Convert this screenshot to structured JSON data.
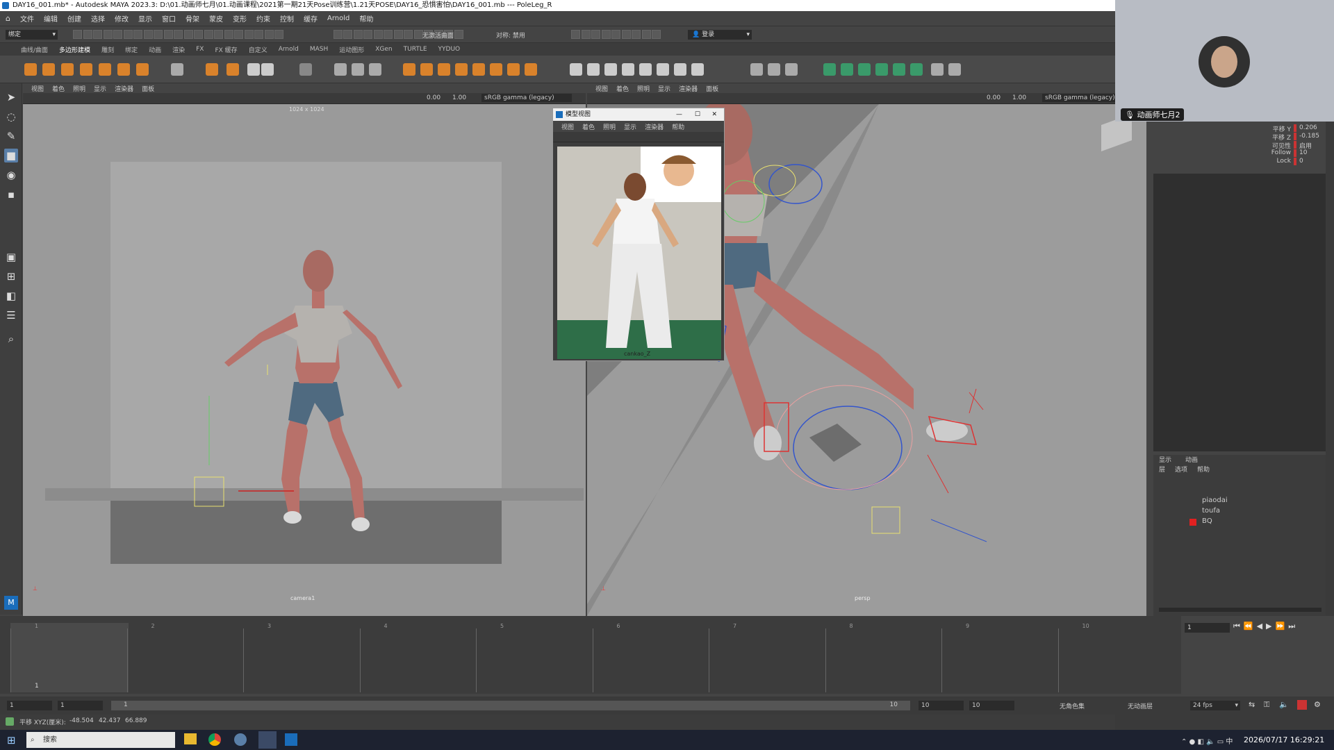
{
  "window": {
    "title": "DAY16_001.mb* - Autodesk MAYA 2023.3: D:\\01.动画师七月\\01.动画课程\\2021第一期21天Pose训练营\\1.21天POSE\\DAY16_恐惧害怕\\DAY16_001.mb   ---   PoleLeg_R"
  },
  "menu": {
    "items": [
      "文件",
      "编辑",
      "创建",
      "选择",
      "修改",
      "显示",
      "窗口",
      "骨架",
      "蒙皮",
      "变形",
      "约束",
      "控制",
      "缓存",
      "Arnold",
      "帮助"
    ]
  },
  "status_line": {
    "mode": "绑定",
    "no_live_surface": "无激活曲面",
    "symmetry": "对称: 禁用",
    "login": "登录"
  },
  "shelf_tabs": [
    "曲线/曲面",
    "多边形建模",
    "雕刻",
    "绑定",
    "动画",
    "渲染",
    "FX",
    "FX 缓存",
    "自定义",
    "Arnold",
    "MASH",
    "运动图形",
    "XGen",
    "TURTLE",
    "YYDUO"
  ],
  "shelf_active_tab": "多边形建模",
  "viewport_menu": [
    "视图",
    "着色",
    "照明",
    "显示",
    "渲染器",
    "面板"
  ],
  "left_viewport": {
    "exposure": "0.00",
    "gamma": "1.00",
    "color_space": "sRGB gamma (legacy)",
    "resolution": "1024 x 1024",
    "camera": "camera1"
  },
  "right_viewport": {
    "exposure": "0.00",
    "gamma": "1.00",
    "color_space": "sRGB gamma (legacy)",
    "camera": "persp"
  },
  "reference_window": {
    "title": "模型视图",
    "menu": [
      "视图",
      "着色",
      "照明",
      "显示",
      "渲染器",
      "帮助"
    ],
    "camera": "cankao_Z"
  },
  "channel_box": {
    "rows": [
      {
        "name": "平移 Y",
        "value": "0.206"
      },
      {
        "name": "平移 Z",
        "value": "-0.185"
      },
      {
        "name": "可见性",
        "value": "启用"
      },
      {
        "name": "Follow",
        "value": "10"
      },
      {
        "name": "Lock",
        "value": "0"
      }
    ]
  },
  "layer_editor": {
    "tabs": [
      "显示",
      "动画"
    ],
    "menu": [
      "层",
      "选项",
      "帮助"
    ],
    "layers": [
      {
        "name": "piaodai",
        "color": "#3c3c3c"
      },
      {
        "name": "toufa",
        "color": "#3c3c3c"
      },
      {
        "name": "BQ",
        "color": "#e02020"
      }
    ]
  },
  "webcam": {
    "caption": "动画师七月2"
  },
  "timeline": {
    "ticks": [
      "1",
      "2",
      "3",
      "4",
      "5",
      "6",
      "7",
      "8",
      "9",
      "10"
    ],
    "current_frame": "1",
    "frame_field": "1"
  },
  "range": {
    "start": "1",
    "playback_start": "1",
    "slider_start": "1",
    "slider_end": "10",
    "playback_end": "10",
    "end": "10",
    "character_set": "无角色集",
    "anim_layer": "无动画层",
    "fps": "24 fps"
  },
  "command_line": {
    "label": "平移 XYZ(厘米):",
    "x": "-48.504",
    "y": "42.437",
    "z": "66.889"
  },
  "taskbar": {
    "search": "搜索",
    "datetime": "2026/07/17 16:29:21"
  },
  "colors": {
    "bg": "#444444",
    "viewport": "#9a9a9a",
    "accent": "#5a7fa8"
  }
}
